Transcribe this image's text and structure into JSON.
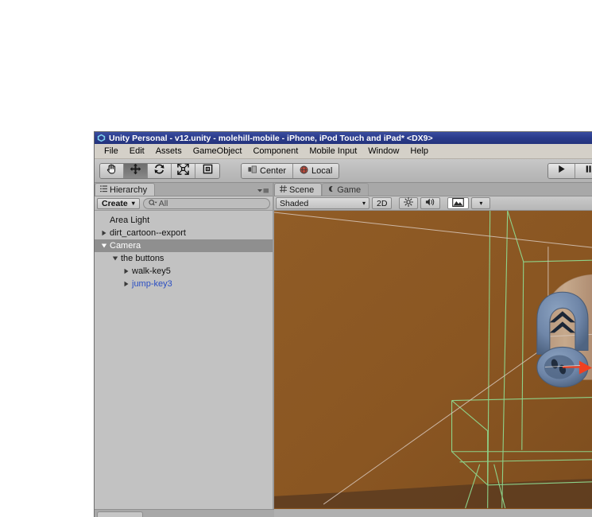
{
  "window": {
    "title": "Unity Personal - v12.unity - molehill-mobile - iPhone, iPod Touch and iPad* <DX9>",
    "icon": "unity-logo-icon"
  },
  "menu": {
    "items": [
      {
        "label": "File"
      },
      {
        "label": "Edit"
      },
      {
        "label": "Assets"
      },
      {
        "label": "GameObject"
      },
      {
        "label": "Component"
      },
      {
        "label": "Mobile Input"
      },
      {
        "label": "Window"
      },
      {
        "label": "Help"
      }
    ]
  },
  "toolbar": {
    "tools": [
      {
        "name": "hand-tool",
        "icon": "hand-icon",
        "active": false
      },
      {
        "name": "move-tool",
        "icon": "move-arrows-icon",
        "active": true
      },
      {
        "name": "rotate-tool",
        "icon": "rotate-icon",
        "active": false
      },
      {
        "name": "scale-tool",
        "icon": "scale-icon",
        "active": false
      },
      {
        "name": "rect-tool",
        "icon": "rect-transform-icon",
        "active": false
      }
    ],
    "pivot_mode": "Center",
    "pivot_rotation": "Local",
    "pivot_mode_icon": "pivot-center-icon",
    "pivot_rotation_icon": "globe-local-icon",
    "play_label": "play-icon"
  },
  "hierarchy": {
    "tab_label": "Hierarchy",
    "tab_icon": "hierarchy-icon",
    "create_label": "Create",
    "create_caret": "▾",
    "search_placeholder": "All",
    "search_value": "",
    "search_icon": "search-icon",
    "tree": [
      {
        "label": "Area Light",
        "depth": 0,
        "arrow": "none",
        "selected": false,
        "prefab": false
      },
      {
        "label": "dirt_cartoon--export",
        "depth": 0,
        "arrow": "collapsed",
        "selected": false,
        "prefab": false
      },
      {
        "label": "Camera",
        "depth": 0,
        "arrow": "expanded",
        "selected": true,
        "prefab": false
      },
      {
        "label": "the buttons",
        "depth": 1,
        "arrow": "expanded",
        "selected": false,
        "prefab": false
      },
      {
        "label": "walk-key5",
        "depth": 2,
        "arrow": "collapsed",
        "selected": false,
        "prefab": false
      },
      {
        "label": "jump-key3",
        "depth": 2,
        "arrow": "collapsed",
        "selected": false,
        "prefab": true
      }
    ]
  },
  "scene_panel": {
    "tabs": [
      {
        "label": "Scene",
        "icon": "scene-grid-icon",
        "active": true
      },
      {
        "label": "Game",
        "icon": "game-moon-icon",
        "active": false
      }
    ],
    "shading_mode": "Shaded",
    "shading_caret": "▾",
    "view_2d_label": "2D",
    "lighting_icon": "sun-icon",
    "audio_icon": "speaker-icon",
    "effects_icon": "image-icon",
    "effects_caret": "▾"
  },
  "colors": {
    "title_bar": "#2b3c8c",
    "menu_bar": "#d4d0c8",
    "panel_bg": "#c2c2c2",
    "selection_row": "#8f8f8f",
    "prefab_text": "#2a4ec2",
    "dirt": "#8a5622",
    "dirt_shadow": "#5a3a20",
    "wireframe_green": "#8fd98f",
    "camera_guide": "#d8c8bc",
    "button_blue": "#6f86a8",
    "arch_tan": "#c1a184",
    "gizmo_red": "#f04020"
  },
  "scene": {
    "objects": [
      {
        "name": "dirt-ground-plane",
        "color": "#8a5622"
      },
      {
        "name": "tunnel-arch",
        "color": "#c1a184"
      },
      {
        "name": "jump-button",
        "icon": "double-chevron-up-icon",
        "color": "#6f86a8"
      },
      {
        "name": "walk-button",
        "icon": "footprint-icon",
        "color": "#6f86a8"
      },
      {
        "name": "camera-frustum",
        "color": "#8fd98f"
      },
      {
        "name": "move-gizmo-x-axis",
        "color": "#f04020"
      }
    ]
  }
}
